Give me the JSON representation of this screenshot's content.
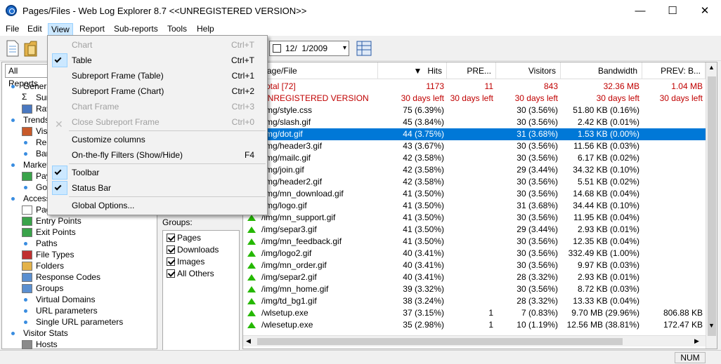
{
  "window": {
    "title": "Pages/Files - Web Log Explorer 8.7 <<UNREGISTERED VERSION>>",
    "minimize": "—",
    "maximize": "☐",
    "close": "✕"
  },
  "menu": {
    "file": "File",
    "edit": "Edit",
    "view": "View",
    "report": "Report",
    "subreports": "Sub-reports",
    "tools": "Tools",
    "help": "Help"
  },
  "toolbar": {
    "date": "12/  1/2009"
  },
  "view_menu": [
    {
      "label": "Chart",
      "shortcut": "Ctrl+T",
      "disabled": true
    },
    {
      "label": "Table",
      "shortcut": "Ctrl+T",
      "checked": true
    },
    {
      "label": "Subreport Frame (Table)",
      "shortcut": "Ctrl+1"
    },
    {
      "label": "Subreport Frame (Chart)",
      "shortcut": "Ctrl+2"
    },
    {
      "label": "Chart Frame",
      "shortcut": "Ctrl+3",
      "disabled": true
    },
    {
      "label": "Close Subreport Frame",
      "shortcut": "Ctrl+0",
      "disabled": true
    },
    {
      "label": "Customize columns",
      "shortcut": ""
    },
    {
      "label": "On-the-fly Filters (Show/Hide)",
      "shortcut": "F4"
    },
    {
      "label": "Toolbar",
      "shortcut": "",
      "checked": true
    },
    {
      "label": "Status Bar",
      "shortcut": "",
      "checked": true
    },
    {
      "label": "Global Options...",
      "shortcut": ""
    }
  ],
  "left_panel": {
    "tab": "All Reports",
    "tree": [
      "General",
      "Sum",
      "Raw",
      "Trends",
      "Visit",
      "Rec",
      "Ban",
      "Marketin",
      "Pay",
      "Goa",
      "Access",
      "Pag",
      "Entry Points",
      "Exit Points",
      "Paths",
      "File Types",
      "Folders",
      "Response Codes",
      "Groups",
      "Virtual Domains",
      "URL parameters",
      "Single URL parameters",
      "Visitor Stats",
      "Hosts"
    ]
  },
  "groups": {
    "label": "Groups:",
    "items": [
      "Pages",
      "Downloads",
      "Images",
      "All Others"
    ]
  },
  "grid": {
    "headers": [
      "Page/File",
      "Hits",
      "PRE...",
      "Visitors",
      "Bandwidth",
      "PREV: B..."
    ],
    "total_row": [
      "Total [72]",
      "1173",
      "11",
      "843",
      "32.36 MB",
      "1.04 MB"
    ],
    "unreg_row": [
      "UNREGISTERED VERSION",
      "30 days left",
      "30 days left",
      "30 days left",
      "30 days left",
      "30 days left"
    ],
    "rows": [
      [
        "/img/style.css",
        "75 (6.39%)",
        "",
        "30 (3.56%)",
        "51.80 KB (0.16%)",
        ""
      ],
      [
        "/img/slash.gif",
        "45 (3.84%)",
        "",
        "30 (3.56%)",
        "2.42 KB (0.01%)",
        ""
      ],
      [
        "/img/dot.gif",
        "44 (3.75%)",
        "",
        "31 (3.68%)",
        "1.53 KB (0.00%)",
        ""
      ],
      [
        "/img/header3.gif",
        "43 (3.67%)",
        "",
        "30 (3.56%)",
        "11.56 KB (0.03%)",
        ""
      ],
      [
        "/img/mailc.gif",
        "42 (3.58%)",
        "",
        "30 (3.56%)",
        "6.17 KB (0.02%)",
        ""
      ],
      [
        "/img/join.gif",
        "42 (3.58%)",
        "",
        "29 (3.44%)",
        "34.32 KB (0.10%)",
        ""
      ],
      [
        "/img/header2.gif",
        "42 (3.58%)",
        "",
        "30 (3.56%)",
        "5.51 KB (0.02%)",
        ""
      ],
      [
        "/img/mn_download.gif",
        "41 (3.50%)",
        "",
        "30 (3.56%)",
        "14.68 KB (0.04%)",
        ""
      ],
      [
        "/img/logo.gif",
        "41 (3.50%)",
        "",
        "31 (3.68%)",
        "34.44 KB (0.10%)",
        ""
      ],
      [
        "/img/mn_support.gif",
        "41 (3.50%)",
        "",
        "30 (3.56%)",
        "11.95 KB (0.04%)",
        ""
      ],
      [
        "/img/separ3.gif",
        "41 (3.50%)",
        "",
        "29 (3.44%)",
        "2.93 KB (0.01%)",
        ""
      ],
      [
        "/img/mn_feedback.gif",
        "41 (3.50%)",
        "",
        "30 (3.56%)",
        "12.35 KB (0.04%)",
        ""
      ],
      [
        "/img/logo2.gif",
        "40 (3.41%)",
        "",
        "30 (3.56%)",
        "332.49 KB (1.00%)",
        ""
      ],
      [
        "/img/mn_order.gif",
        "40 (3.41%)",
        "",
        "30 (3.56%)",
        "9.97 KB (0.03%)",
        ""
      ],
      [
        "/img/separ2.gif",
        "40 (3.41%)",
        "",
        "28 (3.32%)",
        "2.93 KB (0.01%)",
        ""
      ],
      [
        "/img/mn_home.gif",
        "39 (3.32%)",
        "",
        "30 (3.56%)",
        "8.72 KB (0.03%)",
        ""
      ],
      [
        "/img/td_bg1.gif",
        "38 (3.24%)",
        "",
        "28 (3.32%)",
        "13.33 KB (0.04%)",
        ""
      ],
      [
        "/wlsetup.exe",
        "37 (3.15%)",
        "1",
        "7 (0.83%)",
        "9.70 MB (29.96%)",
        "806.88 KB"
      ],
      [
        "/wlesetup.exe",
        "35 (2.98%)",
        "1",
        "10 (1.19%)",
        "12.56 MB (38.81%)",
        "172.47 KB"
      ]
    ]
  },
  "status": {
    "num": "NUM"
  }
}
